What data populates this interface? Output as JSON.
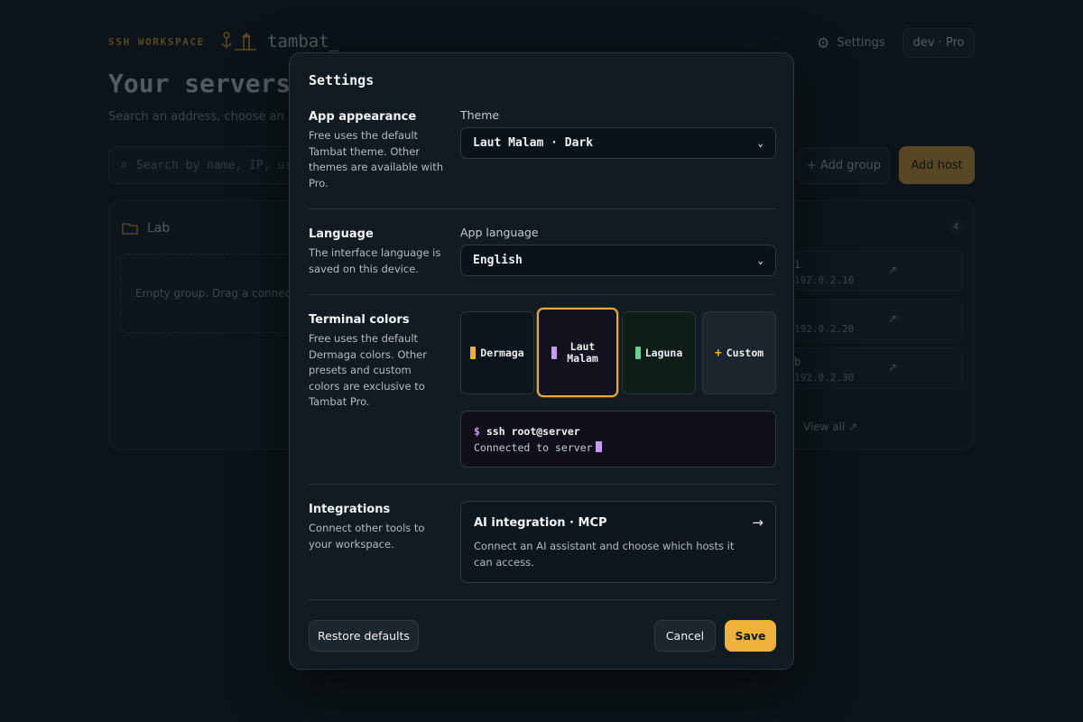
{
  "background": {
    "brand_tag": "SSH WORKSPACE",
    "brand_name": "tambat_",
    "nav_settings": "Settings",
    "nav_user": "dev · Pro",
    "title": "Your servers,",
    "subtitle": "Search an address, choose an an",
    "search_placeholder": "Search by name, IP, us",
    "add_group": "+ Add group",
    "add_host": "Add host",
    "group_name": "Lab",
    "empty_group": "Empty group. Drag a connection",
    "host_count": "4",
    "hosts": [
      {
        "name": "i",
        "ip": "192.0.2.10"
      },
      {
        "name": "",
        "ip": "192.0.2.20"
      },
      {
        "name": "b",
        "ip": "192.0.2.30"
      }
    ],
    "view_all": "View all ↗"
  },
  "modal": {
    "title": "Settings",
    "appearance": {
      "title": "App appearance",
      "desc": "Free uses the default Tambat theme. Other themes are available with Pro.",
      "field_label": "Theme",
      "value": "Laut Malam · Dark"
    },
    "language": {
      "title": "Language",
      "desc": "The interface language is saved on this device.",
      "field_label": "App language",
      "value": "English"
    },
    "terminal": {
      "title": "Terminal colors",
      "desc": "Free uses the default Dermaga colors. Other presets and custom colors are exclusive to Tambat Pro.",
      "presets": [
        {
          "label": "Dermaga",
          "swatch": "#f0b13c",
          "bg": "#0c151b"
        },
        {
          "label": "Laut Malam",
          "swatch": "#c79bf0",
          "bg": "#15121f",
          "selected": true
        },
        {
          "label": "Laguna",
          "swatch": "#6fce92",
          "bg": "#0f1d17"
        },
        {
          "label": "Custom",
          "swatch": "+",
          "bg": "#1a252d"
        }
      ],
      "preview_line1": "ssh root@server",
      "preview_prompt": "$",
      "preview_line2": "Connected to server"
    },
    "integrations": {
      "title": "Integrations",
      "desc": "Connect other tools to your workspace.",
      "card_title": "AI integration · MCP",
      "card_desc": "Connect an AI assistant and choose which hosts it can access.",
      "card_arrow": "→"
    },
    "buttons": {
      "restore": "Restore defaults",
      "cancel": "Cancel",
      "save": "Save"
    }
  },
  "colors": {
    "accent": "#f0b13c",
    "lavender": "#c79bf0",
    "green": "#6fce92"
  }
}
